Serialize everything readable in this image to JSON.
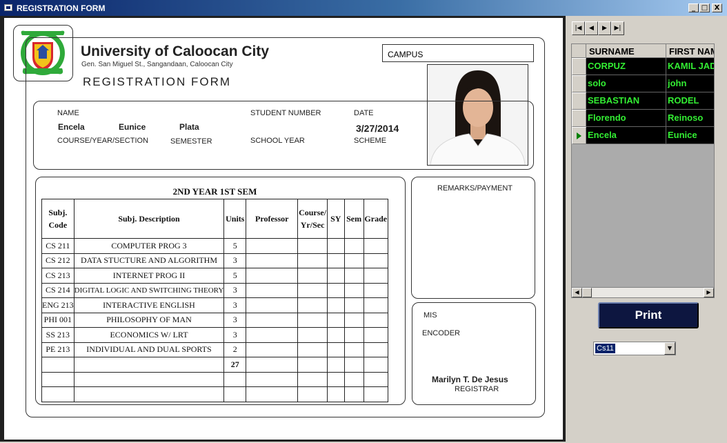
{
  "window": {
    "title": "REGISTRATION FORM",
    "buttons": [
      "_",
      "□",
      "X"
    ]
  },
  "header": {
    "university": "University of Caloocan City",
    "address": "Gen. San Miguel St., Sangandaan, Caloocan City",
    "form_title": "REGISTRATION FORM",
    "campus_label": "CAMPUS"
  },
  "student": {
    "name_label": "NAME",
    "surname": "Encela",
    "first_name": "Eunice",
    "middle_name": "Plata",
    "student_number_label": "STUDENT NUMBER",
    "date_label": "DATE",
    "date": "3/27/2014",
    "course_label": "COURSE/YEAR/SECTION",
    "semester_label": "SEMESTER",
    "school_year_label": "SCHOOL YEAR",
    "scheme_label": "SCHEME"
  },
  "schedule": {
    "caption": "2ND YEAR 1ST SEM",
    "headers": [
      "Subj. Code",
      "Subj. Description",
      "Units",
      "Professor",
      "Course/ Yr/Sec",
      "SY",
      "Sem",
      "Grade"
    ],
    "rows": [
      {
        "code": "CS 211",
        "desc": "COMPUTER PROG 3",
        "units": "5"
      },
      {
        "code": "CS 212",
        "desc": "DATA STUCTURE AND ALGORITHM",
        "units": "3"
      },
      {
        "code": "CS 213",
        "desc": "INTERNET PROG II",
        "units": "5"
      },
      {
        "code": "CS 214",
        "desc": "DIGITAL LOGIC AND SWITCHING THEORY",
        "units": "3"
      },
      {
        "code": "ENG 213",
        "desc": "INTERACTIVE ENGLISH",
        "units": "3"
      },
      {
        "code": "PHI 001",
        "desc": "PHILOSOPHY OF MAN",
        "units": "3"
      },
      {
        "code": "SS 213",
        "desc": "ECONOMICS W/ LRT",
        "units": "3"
      },
      {
        "code": "PE 213",
        "desc": "INDIVIDUAL AND DUAL SPORTS",
        "units": "2"
      }
    ],
    "total_units": "27"
  },
  "remarks_label": "REMARKS/PAYMENT",
  "signatory": {
    "mis_label": "MIS",
    "encoder_label": "ENCODER",
    "registrar_name": "Marilyn T.  De Jesus",
    "registrar_title": "REGISTRAR"
  },
  "grid": {
    "headers": [
      "SURNAME",
      "FIRST NAM"
    ],
    "rows": [
      {
        "surname": "CORPUZ",
        "first": "KAMIL JAD"
      },
      {
        "surname": "solo",
        "first": "john"
      },
      {
        "surname": "SEBASTIAN",
        "first": "RODEL"
      },
      {
        "surname": "Florendo",
        "first": "Reinoso"
      },
      {
        "surname": "Encela",
        "first": "Eunice"
      }
    ],
    "selected_row": 4
  },
  "print_label": "Print",
  "combo_value": "Cs11",
  "colors": {
    "grid_text": "#33ee33",
    "print_bg": "#0d1640",
    "titlebar": "#0a246a"
  }
}
